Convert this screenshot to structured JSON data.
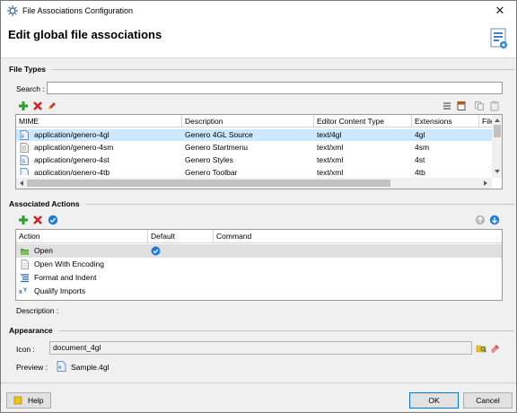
{
  "window": {
    "title": "File Associations Configuration",
    "close_glyph": "✕"
  },
  "header": {
    "heading": "Edit global file associations"
  },
  "file_types": {
    "section_title": "File Types",
    "search_label": "Search :",
    "search_value": "",
    "sort_indicator": "^",
    "columns": [
      "MIME",
      "Description",
      "Editor Content Type",
      "Extensions",
      "File"
    ],
    "rows": [
      {
        "mime": "application/genero-4gl",
        "description": "Genero 4GL Source",
        "content_type": "text/4gl",
        "extensions": "4gl",
        "icon": "4gl-file-icon",
        "selected": true
      },
      {
        "mime": "application/genero-4sm",
        "description": "Genero Startmenu",
        "content_type": "text/xml",
        "extensions": "4sm",
        "icon": "startmenu-file-icon",
        "selected": false
      },
      {
        "mime": "application/genero-4st",
        "description": "Genero Styles",
        "content_type": "text/xml",
        "extensions": "4st",
        "icon": "styles-file-icon",
        "selected": false
      },
      {
        "mime": "application/genero-4tb",
        "description": "Genero Toolbar",
        "content_type": "text/xml",
        "extensions": "4tb",
        "icon": "toolbar-file-icon",
        "selected": false
      }
    ]
  },
  "associated_actions": {
    "section_title": "Associated  Actions",
    "columns": [
      "Action",
      "Default",
      "Command"
    ],
    "rows": [
      {
        "action": "Open",
        "default": true,
        "command": "",
        "icon": "open-icon",
        "highlighted": true
      },
      {
        "action": "Open With Encoding",
        "default": false,
        "command": "",
        "icon": "document-icon",
        "highlighted": false
      },
      {
        "action": "Format and Indent",
        "default": false,
        "command": "",
        "icon": "format-icon",
        "highlighted": false
      },
      {
        "action": "Qualify Imports",
        "default": false,
        "command": "",
        "icon": "qualify-icon",
        "highlighted": false
      }
    ],
    "description_label": "Description :",
    "description_value": ""
  },
  "appearance": {
    "section_title": "Appearance",
    "icon_label": "Icon :",
    "icon_value": "document_4gl",
    "preview_label": "Preview :",
    "preview_value": "Sample.4gl"
  },
  "footer": {
    "help_label": "Help",
    "ok_label": "OK",
    "cancel_label": "Cancel"
  },
  "colors": {
    "selection": "#cce8ff",
    "highlight": "#e0e0e0",
    "add_green": "#2e9e2e",
    "remove_red": "#d42020",
    "check_blue": "#1e7bd8",
    "primary_border": "#0078d7"
  }
}
